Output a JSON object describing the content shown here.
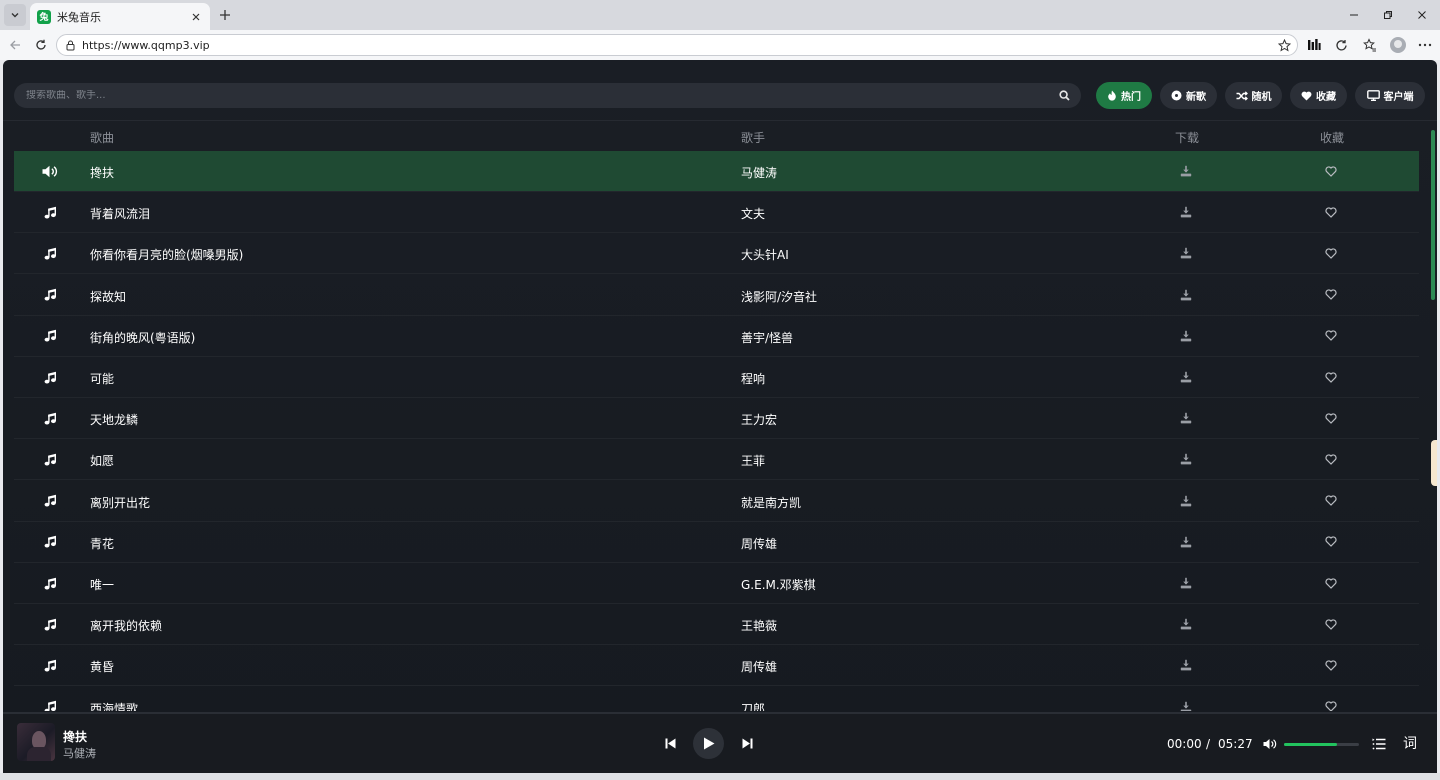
{
  "browser": {
    "tab_title": "米兔音乐",
    "favicon_text": "兔",
    "url": "https://www.qqmp3.vip"
  },
  "search": {
    "placeholder": "搜索歌曲、歌手..."
  },
  "chips": [
    {
      "label": "热门",
      "icon": "fire-icon",
      "active": true
    },
    {
      "label": "新歌",
      "icon": "disc-icon",
      "active": false
    },
    {
      "label": "随机",
      "icon": "shuffle-icon",
      "active": false
    },
    {
      "label": "收藏",
      "icon": "heart-icon",
      "active": false
    },
    {
      "label": "客户端",
      "icon": "desktop-icon",
      "active": false
    }
  ],
  "columns": {
    "song": "歌曲",
    "artist": "歌手",
    "download": "下载",
    "favorite": "收藏"
  },
  "songs": [
    {
      "title": "搀扶",
      "artist": "马健涛",
      "playing": true
    },
    {
      "title": "背着风流泪",
      "artist": "文夫"
    },
    {
      "title": "你看你看月亮的脸(烟嗓男版)",
      "artist": "大头针AI"
    },
    {
      "title": "探故知",
      "artist": "浅影阿/汐音社"
    },
    {
      "title": "街角的晚风(粤语版)",
      "artist": "善宇/怪兽"
    },
    {
      "title": "可能",
      "artist": "程响"
    },
    {
      "title": "天地龙鳞",
      "artist": "王力宏"
    },
    {
      "title": "如愿",
      "artist": "王菲"
    },
    {
      "title": "离别开出花",
      "artist": "就是南方凯"
    },
    {
      "title": "青花",
      "artist": "周传雄"
    },
    {
      "title": "唯一",
      "artist": "G.E.M.邓紫棋"
    },
    {
      "title": "离开我的依赖",
      "artist": "王艳薇"
    },
    {
      "title": "黄昏",
      "artist": "周传雄"
    },
    {
      "title": "西海情歌",
      "artist": "刀郎"
    }
  ],
  "player": {
    "title": "搀扶",
    "artist": "马健涛",
    "current_time": "00:00",
    "separator": "/",
    "duration": "05:27",
    "volume_fraction": 0.7,
    "lyric_label": "词"
  },
  "colors": {
    "accent": "#1f7a44",
    "playing_row": "#1f4a33",
    "volume": "#22c35e"
  }
}
